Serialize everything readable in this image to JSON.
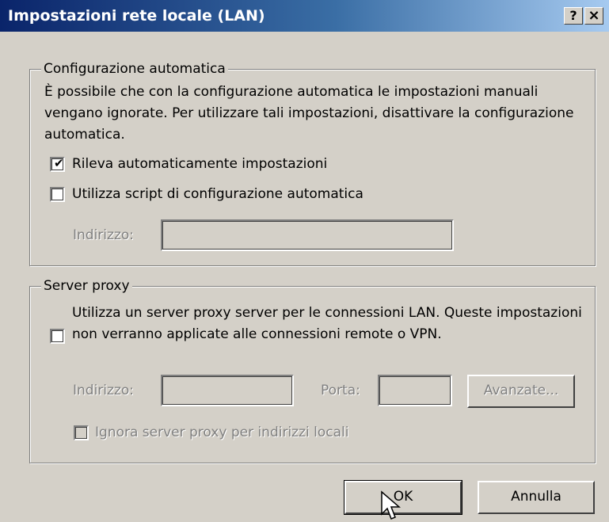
{
  "window": {
    "title": "Impostazioni rete locale (LAN)",
    "help_label": "?",
    "close_label": "×"
  },
  "auto_config": {
    "legend": "Configurazione automatica",
    "description": "È possibile che con la configurazione automatica le impostazioni manuali vengano ignorate. Per utilizzare tali impostazioni, disattivare la configurazione automatica.",
    "detect_label": "Rileva automaticamente impostazioni",
    "detect_checked": true,
    "script_label": "Utilizza script di configurazione automatica",
    "script_checked": false,
    "address_label": "Indirizzo:",
    "address_value": ""
  },
  "proxy": {
    "legend": "Server proxy",
    "use_proxy_label": "Utilizza un server proxy server per le connessioni LAN. Queste impostazioni non verranno applicate alle connessioni remote o VPN.",
    "use_proxy_checked": false,
    "address_label": "Indirizzo:",
    "address_value": "",
    "port_label": "Porta:",
    "port_value": "",
    "advanced_label": "Avanzate...",
    "bypass_label": "Ignora server proxy per indirizzi locali",
    "bypass_checked": false
  },
  "buttons": {
    "ok_label": "OK",
    "cancel_label": "Annulla"
  },
  "colors": {
    "face": "#d4d0c8",
    "title_start": "#0a246a",
    "title_end": "#a6caf0",
    "disabled_text": "#808080"
  }
}
